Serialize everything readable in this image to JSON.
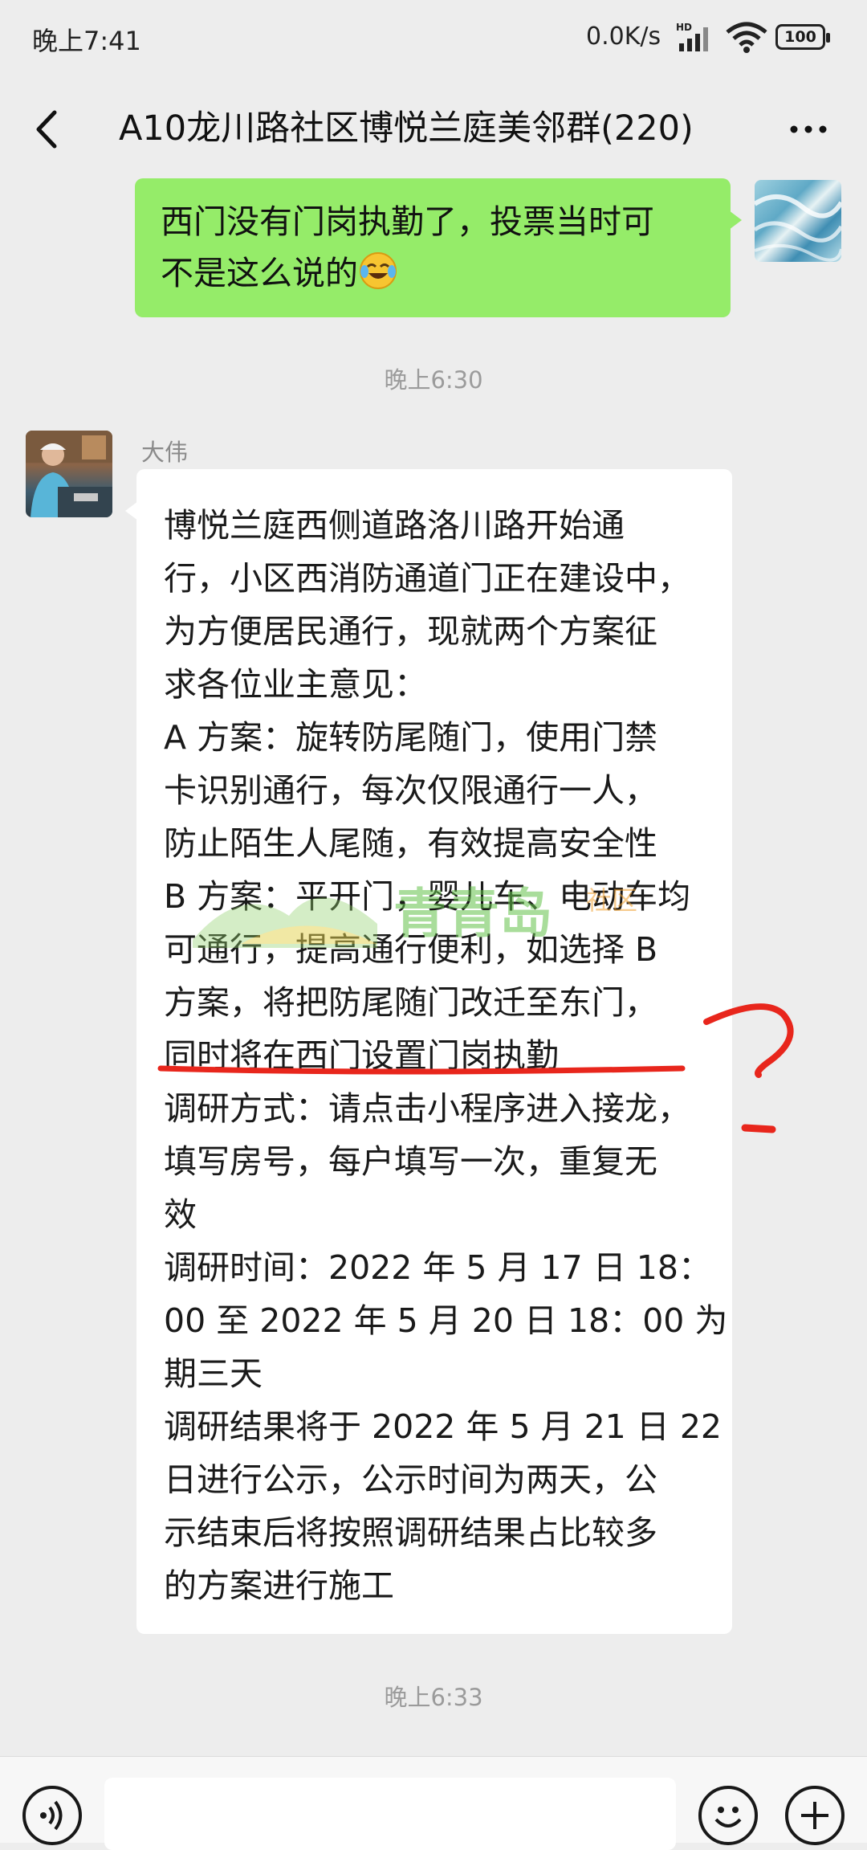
{
  "status_bar": {
    "time": "晚上7:41",
    "net_speed": "0.0K/s",
    "battery": "100",
    "icons": [
      "hd-signal-icon",
      "wifi-icon",
      "battery-icon"
    ]
  },
  "header": {
    "title": "A10龙川路社区博悦兰庭美邻群(220)",
    "back_icon": "chevron-left-icon",
    "more_icon": "more-icon"
  },
  "messages": [
    {
      "type": "outgoing",
      "text": "西门没有门岗执勤了，投票当时可不是这么说的",
      "lines": [
        "西门没有门岗执勤了，投票当时可",
        "不是这么说的"
      ],
      "emoji": "crying-laughing-emoji"
    },
    {
      "type": "timestamp",
      "text": "晚上6:30"
    },
    {
      "type": "incoming",
      "sender": "大伟",
      "lines": [
        "博悦兰庭西侧道路洛川路开始通",
        "行，小区西消防通道门正在建设中，",
        "为方便居民通行，现就两个方案征",
        "求各位业主意见：",
        "A 方案：旋转防尾随门，使用门禁",
        "卡识别通行，每次仅限通行一人，",
        "防止陌生人尾随，有效提高安全性",
        "B 方案：平开门，婴儿车、电动车均",
        "可通行，提高通行便利，如选择 B",
        "方案，将把防尾随门改迁至东门，",
        "同时将在西门设置门岗执勤",
        "调研方式：请点击小程序进入接龙，",
        "填写房号，每户填写一次，重复无",
        "效",
        "调研时间：2022 年 5 月 17 日 18：",
        "00 至 2022 年 5 月 20 日 18：00 为",
        "期三天",
        "调研结果将于 2022 年 5 月 21 日 22",
        "日进行公示，公示时间为两天，公",
        "示结束后将按照调研结果占比较多",
        "的方案进行施工"
      ]
    },
    {
      "type": "timestamp",
      "text": "晚上6:33"
    }
  ],
  "watermark": {
    "text": "青青岛",
    "suffix": "社区"
  },
  "annotation": {
    "color": "#e8261c"
  },
  "input_bar": {
    "voice_icon": "voice-icon",
    "emoji_icon": "emoji-icon",
    "plus_icon": "plus-icon"
  },
  "colors": {
    "outgoing_bubble": "#95ec69",
    "incoming_bubble": "#ffffff",
    "background": "#ededed"
  }
}
